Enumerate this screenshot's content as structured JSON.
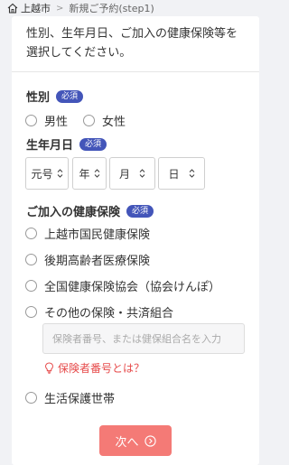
{
  "breadcrumb": {
    "home": "上越市",
    "current": "新規ご予約(step1)"
  },
  "intro": {
    "text": "性別、生年月日、ご加入の健康保険等を選択してください。"
  },
  "required_badge": "必須",
  "gender": {
    "label": "性別",
    "options": [
      "男性",
      "女性"
    ]
  },
  "birthdate": {
    "label": "生年月日",
    "selects": [
      "元号",
      "年",
      "月",
      "日"
    ]
  },
  "insurance": {
    "label": "ご加入の健康保険",
    "options": [
      "上越市国民健康保険",
      "後期高齢者医療保険",
      "全国健康保険協会（協会けんぽ）",
      "その他の保険・共済組合",
      "生活保護世帯"
    ],
    "input_placeholder": "保険者番号、または健保組合名を入力",
    "help_link": "保険者番号とは？"
  },
  "next_button": "次へ",
  "colors": {
    "badge": "#4355b9",
    "accent_red": "#e64a4a",
    "button": "#f47a76",
    "background": "#f1f2f5"
  }
}
